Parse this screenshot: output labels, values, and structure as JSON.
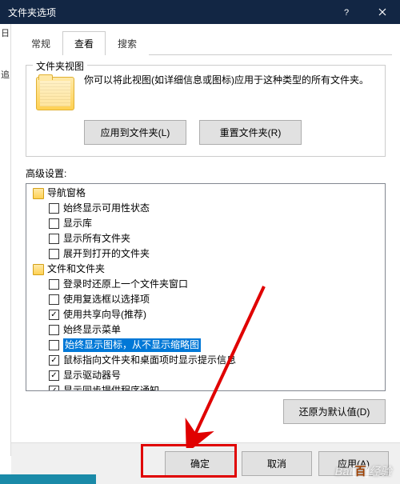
{
  "window": {
    "title": "文件夹选项"
  },
  "tabs": {
    "general": "常规",
    "view": "查看",
    "search": "搜索"
  },
  "folderView": {
    "groupTitle": "文件夹视图",
    "description": "你可以将此视图(如详细信息或图标)应用于这种类型的所有文件夹。",
    "applyBtn": "应用到文件夹(L)",
    "resetBtn": "重置文件夹(R)"
  },
  "advanced": {
    "label": "高级设置:",
    "items": [
      {
        "level": 1,
        "type": "folder",
        "label": "导航窗格"
      },
      {
        "level": 2,
        "type": "check",
        "checked": false,
        "label": "始终显示可用性状态"
      },
      {
        "level": 2,
        "type": "check",
        "checked": false,
        "label": "显示库"
      },
      {
        "level": 2,
        "type": "check",
        "checked": false,
        "label": "显示所有文件夹"
      },
      {
        "level": 2,
        "type": "check",
        "checked": false,
        "label": "展开到打开的文件夹"
      },
      {
        "level": 1,
        "type": "folder",
        "label": "文件和文件夹"
      },
      {
        "level": 2,
        "type": "check",
        "checked": false,
        "label": "登录时还原上一个文件夹窗口"
      },
      {
        "level": 2,
        "type": "check",
        "checked": false,
        "label": "使用复选框以选择项"
      },
      {
        "level": 2,
        "type": "check",
        "checked": true,
        "label": "使用共享向导(推荐)"
      },
      {
        "level": 2,
        "type": "check",
        "checked": false,
        "label": "始终显示菜单"
      },
      {
        "level": 2,
        "type": "check",
        "checked": false,
        "label": "始终显示图标，从不显示缩略图",
        "highlighted": true
      },
      {
        "level": 2,
        "type": "check",
        "checked": true,
        "label": "鼠标指向文件夹和桌面项时显示提示信息"
      },
      {
        "level": 2,
        "type": "check",
        "checked": true,
        "label": "显示驱动器号"
      },
      {
        "level": 2,
        "type": "check",
        "checked": true,
        "label": "显示同步提供程序通知"
      }
    ],
    "restoreBtn": "还原为默认值(D)"
  },
  "dialogButtons": {
    "ok": "确定",
    "cancel": "取消",
    "apply": "应用(A)"
  },
  "leftStrip": {
    "a": "日",
    "b": "追"
  },
  "watermark": {
    "prefix": "Bai",
    "mid": "百",
    "suffix": "经验"
  }
}
